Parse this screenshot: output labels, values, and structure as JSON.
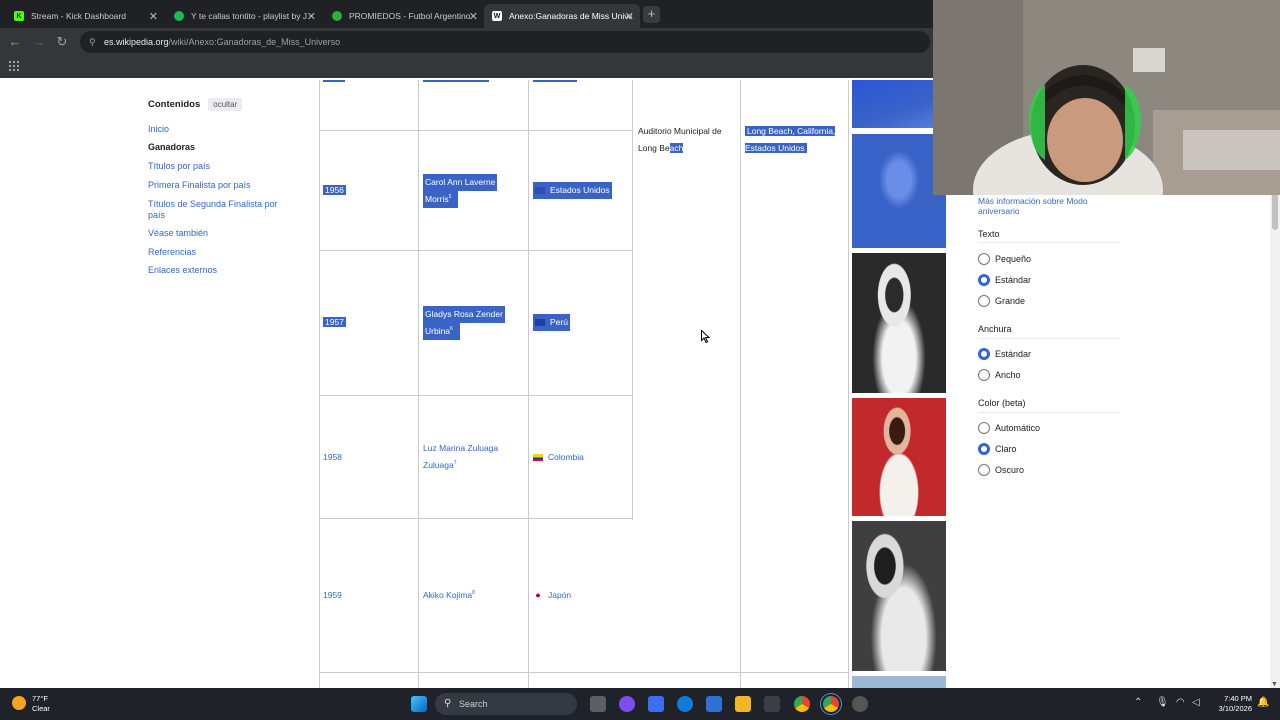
{
  "browser": {
    "tabs": [
      {
        "title": "Stream - Kick Dashboard",
        "icon": "kick-icon",
        "color": "#53fc18",
        "active": false
      },
      {
        "title": "Y te callas tontito - playlist by J",
        "icon": "spotify-icon",
        "color": "#1db954",
        "active": false
      },
      {
        "title": "PROMIEDOS - Futbol Argentino",
        "icon": "promiedos-icon",
        "color": "#2fae3a",
        "active": false
      },
      {
        "title": "Anexo:Ganadoras de Miss Unive",
        "icon": "wikipedia-icon",
        "color": "#ffffff",
        "active": true
      }
    ],
    "url_domain": "es.wikipedia.org",
    "url_path": "/wiki/Anexo:Ganadoras_de_Miss_Universo"
  },
  "toc": {
    "title": "Contenidos",
    "hide_label": "ocultar",
    "items": [
      {
        "label": "Inicio",
        "current": false
      },
      {
        "label": "Ganadoras",
        "current": true
      },
      {
        "label": "Títulos por país",
        "current": false
      },
      {
        "label": "Primera Finalista por país",
        "current": false
      },
      {
        "label": "Títulos de Segunda Finalista por país",
        "current": false
      },
      {
        "label": "Véase también",
        "current": false
      },
      {
        "label": "Referencias",
        "current": false
      },
      {
        "label": "Enlaces externos",
        "current": false
      }
    ]
  },
  "table": {
    "venue": {
      "text_before": "Auditorio Municipal de Long Be",
      "text_selected": "ach"
    },
    "city": "Long Beach, California, Estados Unidos",
    "rows": [
      {
        "year": "1956",
        "name_line1": "Carol Ann Laverne",
        "name_line2": "Morris",
        "ref": "5",
        "country": "Estados Unidos",
        "selected": true
      },
      {
        "year": "1957",
        "name_line1": "Gladys Rosa Zender",
        "name_line2": "Urbina",
        "ref": "6",
        "country": "Perú",
        "selected": true
      },
      {
        "year": "1958",
        "name_line1": "Luz Marina Zuluaga",
        "name_line2": "Zuluaga",
        "ref": "7",
        "country": "Colombia",
        "selected": false
      },
      {
        "year": "1959",
        "name_line1": "Akiko Kojima",
        "name_line2": "",
        "ref": "8",
        "country": "Japón",
        "selected": false
      }
    ]
  },
  "appearance": {
    "more_info": "Más información sobre Modo aniversario",
    "text_heading": "Texto",
    "text_options": [
      "Pequeño",
      "Estándar",
      "Grande"
    ],
    "text_selected": "Estándar",
    "width_heading": "Anchura",
    "width_options": [
      "Estándar",
      "Ancho"
    ],
    "width_selected": "Estándar",
    "color_heading": "Color (beta)",
    "color_options": [
      "Automático",
      "Claro",
      "Oscuro"
    ],
    "color_selected": "Claro"
  },
  "taskbar": {
    "temperature": "77°F",
    "condition": "Clear",
    "search_placeholder": "Search",
    "time": "7:40 PM",
    "date": "3/10/2026"
  },
  "colors": {
    "link": "#3366cc",
    "selection": "#3a63c8",
    "chrome_dark": "#202124"
  }
}
